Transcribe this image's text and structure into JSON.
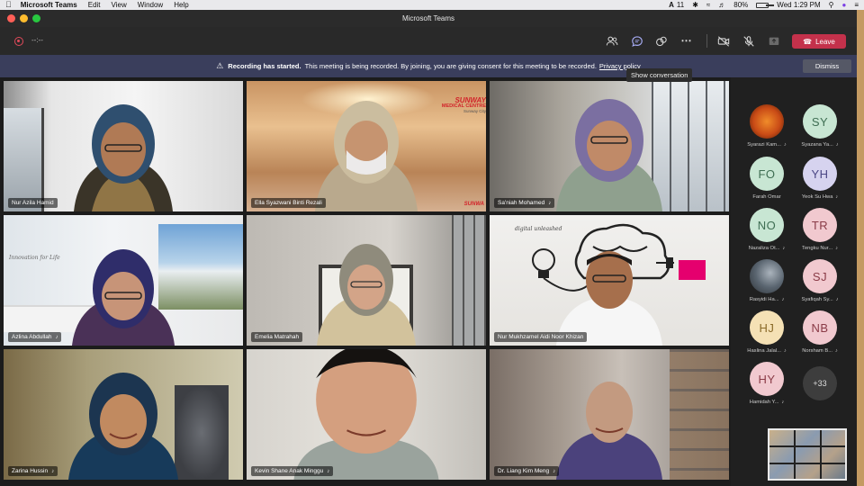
{
  "menubar": {
    "app_name": "Microsoft Teams",
    "items": [
      "Edit",
      "View",
      "Window",
      "Help"
    ],
    "status": {
      "input_source": "A",
      "notification_count": "11",
      "battery": "80%",
      "datetime": "Wed 1:29 PM"
    }
  },
  "window": {
    "title": "Microsoft Teams"
  },
  "toolbar": {
    "timer": "--:--",
    "leave_label": "Leave",
    "tooltip": "Show conversation"
  },
  "banner": {
    "bold_text": "Recording has started.",
    "text": "This meeting is being recorded. By joining, you are giving consent for this meeting to be recorded.",
    "link_text": "Privacy policy",
    "dismiss_label": "Dismiss"
  },
  "videos": [
    {
      "name": "Nur Azila Hamid"
    },
    {
      "name": "Ella Syazwani Binti  Rezali",
      "brand": "SUNWAY",
      "brand_sub": "MEDICAL CENTRE",
      "brand_sub2": "Sunway City",
      "brand_small": "SUNWA"
    },
    {
      "name": "Sa'niah Mohamed"
    },
    {
      "name": "Azlina Abdullah",
      "wall_text": "Innovation for Life"
    },
    {
      "name": "Emelia Matrahah"
    },
    {
      "name": "Nur Mukhzamel Aidi Noor Khizan",
      "title_text": "digital unleashed"
    },
    {
      "name": "Zarina Hussin"
    },
    {
      "name": "Kevin Shane Anak Minggu"
    },
    {
      "name": "Dr. Liang Kim Meng"
    }
  ],
  "roster": {
    "participants": [
      {
        "initials": "",
        "name": "Syarazi Kam...",
        "color": "#d05a1e"
      },
      {
        "initials": "SY",
        "name": "Syazana Ya...",
        "color": "#c8e6d3"
      },
      {
        "initials": "FO",
        "name": "Farah Omar",
        "color": "#c8e6d3"
      },
      {
        "initials": "YH",
        "name": "Yeok Su Hwa",
        "color": "#d6d3ef"
      },
      {
        "initials": "NO",
        "name": "Nazaliza Ot...",
        "color": "#c8e6d3"
      },
      {
        "initials": "TR",
        "name": "Tengku Nur...",
        "color": "#f1c9cf"
      },
      {
        "initials": "",
        "name": "Rasyidi Ha...",
        "color": "#6d7a8a"
      },
      {
        "initials": "SJ",
        "name": "Syafiqah Sy...",
        "color": "#f1c9cf"
      },
      {
        "initials": "HJ",
        "name": "Haslina Jalal...",
        "color": "#f5e1b5"
      },
      {
        "initials": "NB",
        "name": "Norsham B...",
        "color": "#f1c9cf"
      },
      {
        "initials": "HY",
        "name": "Hamidah Y...",
        "color": "#f1c9cf"
      }
    ],
    "more_label": "+33"
  }
}
